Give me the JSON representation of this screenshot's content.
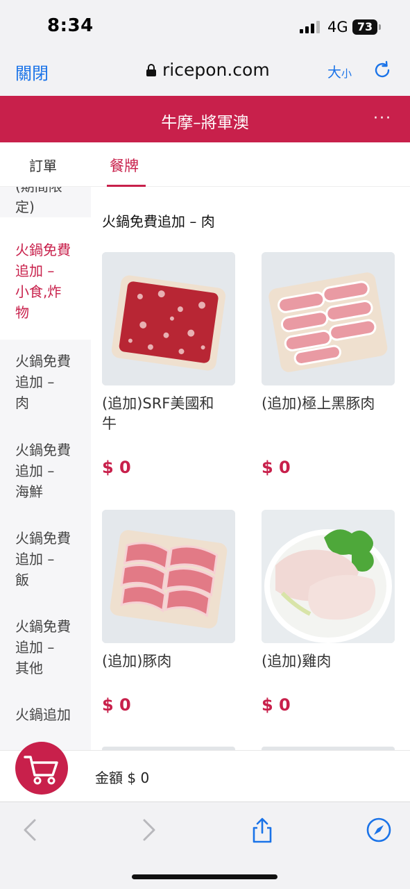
{
  "status_bar": {
    "time": "8:34",
    "network": "4G",
    "battery": "73"
  },
  "browser": {
    "close_label": "關閉",
    "url": "ricepon.com",
    "text_size_big": "大",
    "text_size_small": "小"
  },
  "header": {
    "title": "牛摩–將軍澳",
    "more": "···"
  },
  "tabs": {
    "orders": "訂單",
    "menu": "餐牌"
  },
  "sidebar": {
    "items": [
      {
        "label": "(期間限定)",
        "lines": [
          "(期間限",
          "定)"
        ]
      },
      {
        "label": "火鍋免費追加 – 小食,炸物",
        "lines": [
          "火鍋免費",
          "追加 –",
          "小食,炸",
          "物"
        ]
      },
      {
        "label": "火鍋免費追加 – 肉",
        "lines": [
          "火鍋免費",
          "追加 –",
          "肉"
        ]
      },
      {
        "label": "火鍋免費追加 – 海鮮",
        "lines": [
          "火鍋免費",
          "追加 –",
          "海鮮"
        ]
      },
      {
        "label": "火鍋免費追加 – 飯",
        "lines": [
          "火鍋免費",
          "追加 –",
          "飯"
        ]
      },
      {
        "label": "火鍋免費追加 – 其他",
        "lines": [
          "火鍋免費",
          "追加 –",
          "其他"
        ]
      },
      {
        "label": "火鍋追加",
        "lines": [
          "火鍋追加"
        ]
      }
    ]
  },
  "main": {
    "section_title": "火鍋免費追加 – 肉",
    "items": [
      {
        "name_lines": [
          "(追加)SRF美國和",
          "牛"
        ],
        "price": "$ 0"
      },
      {
        "name_lines": [
          "(追加)極上黑豚肉"
        ],
        "price": "$ 0"
      },
      {
        "name_lines": [
          "(追加)豚肉"
        ],
        "price": "$ 0"
      },
      {
        "name_lines": [
          "(追加)雞肉"
        ],
        "price": "$ 0"
      }
    ]
  },
  "cart": {
    "total_label": "金額 $ 0"
  },
  "colors": {
    "brand": "#c8204b",
    "link": "#1a73e8"
  }
}
